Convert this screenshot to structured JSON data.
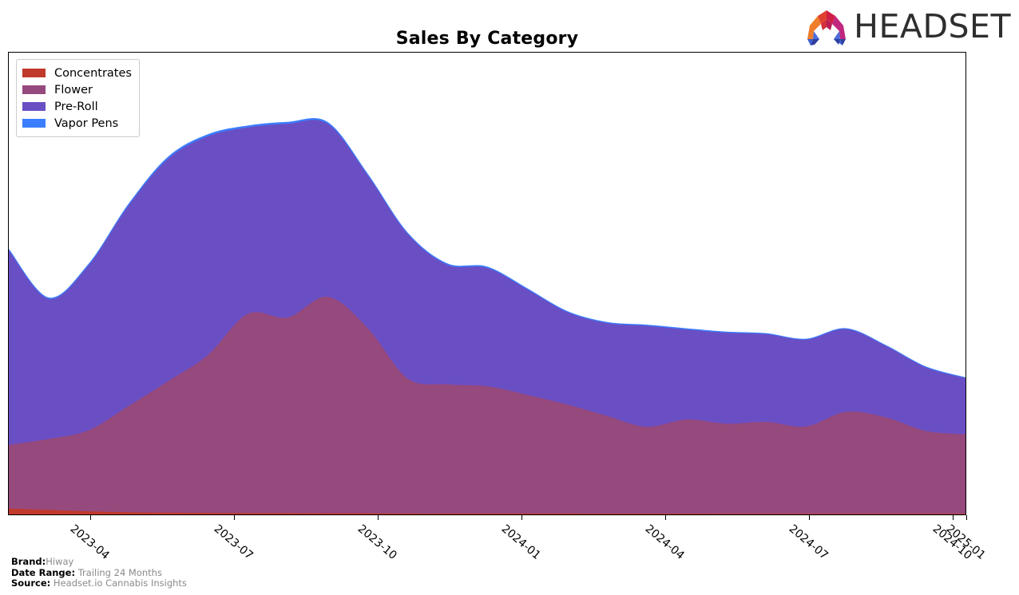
{
  "header": {
    "title": "Sales By Category",
    "logo_wordmark": "HEADSET",
    "logo_colors": {
      "orange": "#f07d2a",
      "red": "#d8273f",
      "magenta": "#c0277e",
      "violet": "#7a2f8f",
      "blue": "#3b5fd0",
      "indigo": "#2f3f9e"
    }
  },
  "footer": {
    "brand_key": "Brand:",
    "brand_value": "Hiway",
    "date_range_key": "Date Range:",
    "date_range_value": "Trailing 24 Months",
    "source_key": "Source:",
    "source_value": "Headset.io Cannabis Insights"
  },
  "chart_data": {
    "type": "area",
    "stacked": true,
    "title": "Sales By Category",
    "xlabel": "",
    "ylabel": "",
    "grid": false,
    "legend_position": "upper-left",
    "axis": {
      "y_ticks_visible": false,
      "x_tick_label_rotation": 40,
      "x_tick_labels": [
        "2023-04",
        "2023-07",
        "2023-10",
        "2024-01",
        "2024-04",
        "2024-07",
        "2024-10",
        "2025-01"
      ],
      "x_tick_positions_frac": [
        0.0855,
        0.2355,
        0.3855,
        0.5355,
        0.6855,
        0.8355,
        0.9855,
        1.0
      ]
    },
    "x": [
      "2023-01",
      "2023-02",
      "2023-03",
      "2023-04",
      "2023-05",
      "2023-06",
      "2023-07",
      "2023-08",
      "2023-09",
      "2023-10",
      "2023-11",
      "2023-12",
      "2024-01",
      "2024-02",
      "2024-03",
      "2024-04",
      "2024-05",
      "2024-06",
      "2024-07",
      "2024-08",
      "2024-09",
      "2024-10",
      "2024-11",
      "2024-12",
      "2025-01"
    ],
    "series": [
      {
        "name": "Concentrates",
        "color": "#c0392b",
        "values": [
          1.2,
          0.9,
          0.6,
          0.4,
          0.3,
          0.25,
          0.2,
          0.2,
          0.15,
          0.15,
          0.1,
          0.1,
          0.1,
          0.1,
          0.1,
          0.08,
          0.08,
          0.08,
          0.05,
          0.05,
          0.05,
          0.05,
          0.05,
          0.05,
          0.05
        ]
      },
      {
        "name": "Flower",
        "color": "#96497d",
        "values": [
          14.0,
          15.6,
          17.8,
          23.3,
          28.9,
          34.7,
          43.8,
          43.0,
          47.6,
          40.7,
          29.7,
          28.4,
          28.0,
          26.1,
          24.0,
          21.5,
          19.1,
          20.7,
          19.8,
          20.2,
          19.2,
          22.4,
          21.2,
          18.2,
          17.5
        ]
      },
      {
        "name": "Pre-Roll",
        "color": "#6a4fc4",
        "values": [
          42.7,
          30.8,
          36.2,
          44.0,
          48.9,
          48.1,
          41.0,
          42.6,
          38.0,
          33.6,
          31.8,
          26.3,
          26.0,
          23.2,
          20.3,
          20.4,
          22.2,
          19.8,
          20.0,
          19.3,
          19.1,
          18.2,
          15.7,
          14.0,
          12.3
        ]
      },
      {
        "name": "Vapor Pens",
        "color": "#3b7eff",
        "values": [
          0.35,
          0.3,
          0.35,
          0.4,
          0.45,
          0.45,
          0.4,
          0.4,
          0.4,
          0.35,
          0.3,
          0.3,
          0.3,
          0.25,
          0.25,
          0.25,
          0.25,
          0.25,
          0.25,
          0.2,
          0.2,
          0.2,
          0.2,
          0.2,
          0.2
        ]
      }
    ],
    "ylim": [
      0,
      101.5
    ]
  }
}
